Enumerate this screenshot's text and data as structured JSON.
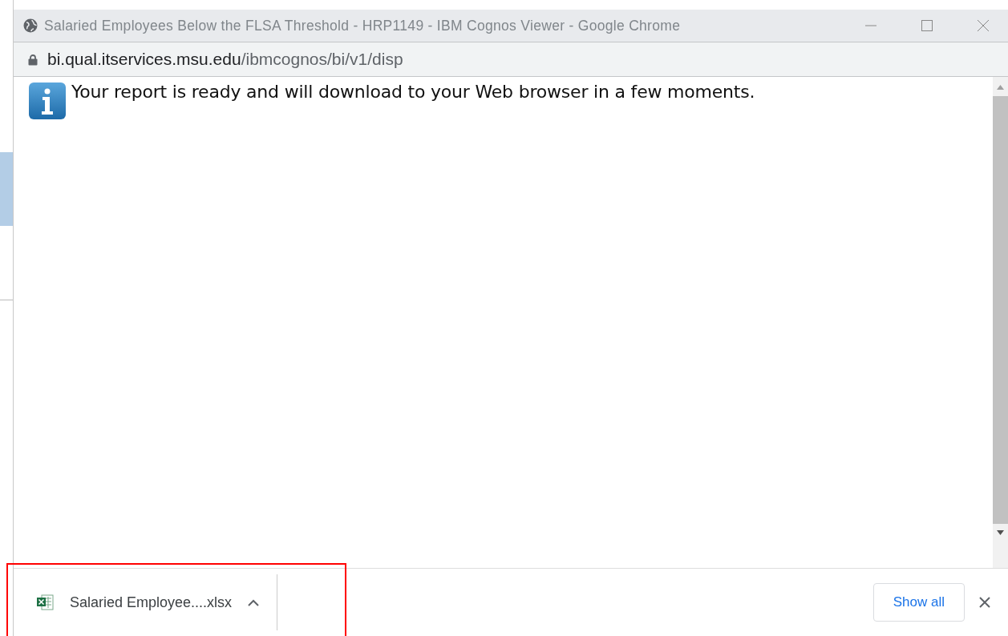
{
  "window": {
    "title": "Salaried Employees Below the FLSA Threshold - HRP1149 - IBM Cognos Viewer - Google Chrome"
  },
  "address_bar": {
    "host": "bi.qual.itservices.msu.edu",
    "path": "/ibmcognos/bi/v1/disp"
  },
  "message": {
    "text": "Your report is ready and will download to your Web browser in a few moments."
  },
  "download_shelf": {
    "items": [
      {
        "file_name": "Salaried Employee....xlsx",
        "highlighted": true
      }
    ],
    "show_all": "Show all"
  }
}
